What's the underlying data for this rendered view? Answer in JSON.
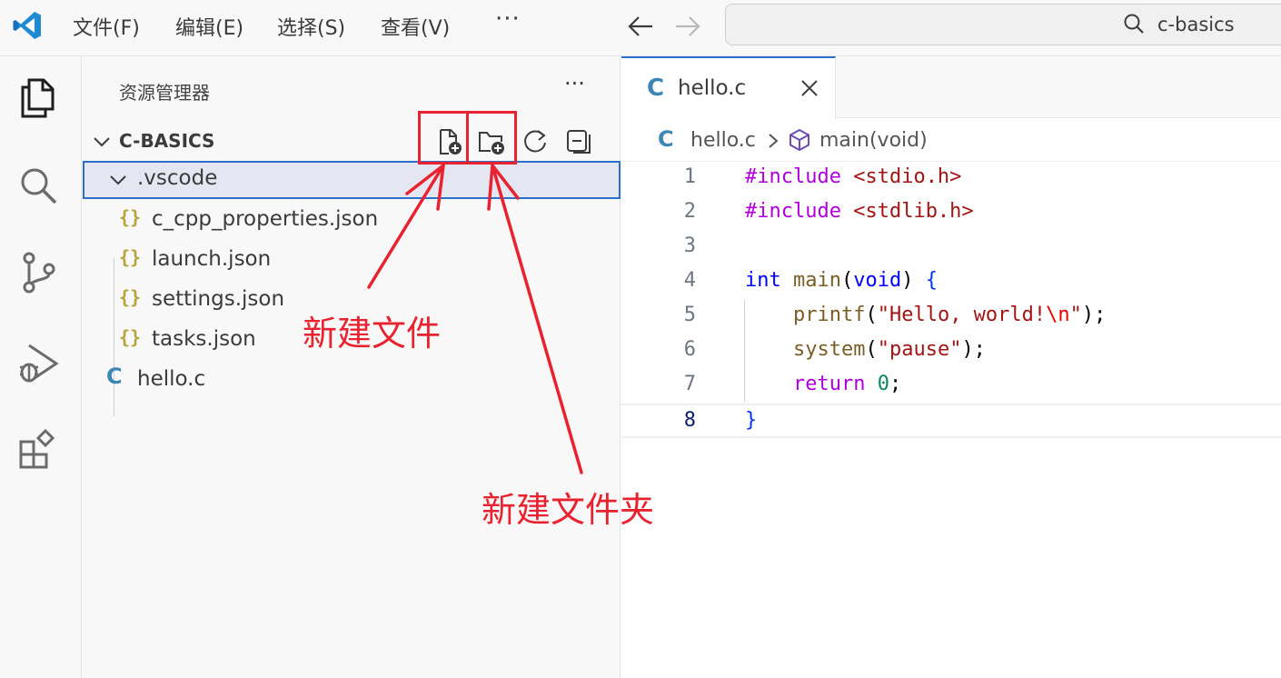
{
  "menu": {
    "file": "文件(F)",
    "edit": "编辑(E)",
    "selection": "选择(S)",
    "view": "查看(V)",
    "more": "···"
  },
  "search": {
    "text": "c-basics"
  },
  "sidebar": {
    "title": "资源管理器",
    "more": "···",
    "root": "C-BASICS",
    "items": [
      {
        "label": ".vscode",
        "icon": "folder-open"
      },
      {
        "label": "c_cpp_properties.json",
        "icon": "{}"
      },
      {
        "label": "launch.json",
        "icon": "{}"
      },
      {
        "label": "settings.json",
        "icon": "{}"
      },
      {
        "label": "tasks.json",
        "icon": "{}"
      },
      {
        "label": "hello.c",
        "icon": "C"
      }
    ]
  },
  "editor": {
    "tab_icon": "C",
    "tab_label": "hello.c",
    "breadcrumb_icon": "C",
    "breadcrumb_file": "hello.c",
    "breadcrumb_symbol": "main(void)",
    "line_numbers": [
      "1",
      "2",
      "3",
      "4",
      "5",
      "6",
      "7",
      "8"
    ],
    "lines": [
      [
        [
          "kw-purple",
          "#include "
        ],
        [
          "str",
          "<stdio.h>"
        ]
      ],
      [
        [
          "kw-purple",
          "#include "
        ],
        [
          "str",
          "<stdlib.h>"
        ]
      ],
      [],
      [
        [
          "kw-blue",
          "int "
        ],
        [
          "fn",
          "main"
        ],
        [
          "plain",
          "("
        ],
        [
          "kw-blue",
          "void"
        ],
        [
          "plain",
          ") "
        ],
        [
          "brace",
          "{"
        ]
      ],
      [
        [
          "plain",
          "    "
        ],
        [
          "fn",
          "printf"
        ],
        [
          "plain",
          "("
        ],
        [
          "str",
          "\"Hello, world!"
        ],
        [
          "esc",
          "\\n"
        ],
        [
          "str",
          "\""
        ],
        [
          "plain",
          ");"
        ]
      ],
      [
        [
          "plain",
          "    "
        ],
        [
          "fn",
          "system"
        ],
        [
          "plain",
          "("
        ],
        [
          "str",
          "\"pause\""
        ],
        [
          "plain",
          ");"
        ]
      ],
      [
        [
          "plain",
          "    "
        ],
        [
          "kw-purple",
          "return "
        ],
        [
          "num",
          "0"
        ],
        [
          "plain",
          ";"
        ]
      ],
      [
        [
          "brace",
          "}"
        ]
      ]
    ]
  },
  "annotations": {
    "new_file": "新建文件",
    "new_folder": "新建文件夹"
  },
  "colors": {
    "accent": "#2a6fc9",
    "annotation": "#e8232f",
    "c_icon": "#3b86b5",
    "json_icon": "#b5a53a"
  }
}
